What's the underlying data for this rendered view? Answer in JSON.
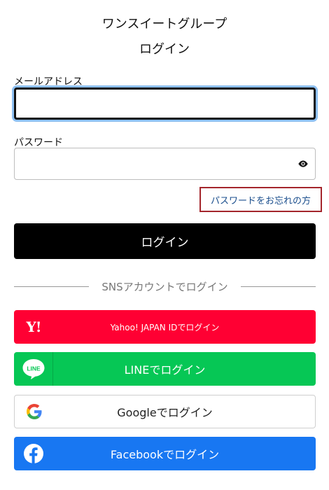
{
  "header": {
    "brand": "ワンスイートグループ",
    "page_title": "ログイン"
  },
  "form": {
    "email_label": "メールアドレス",
    "email_value": "",
    "password_label": "パスワード",
    "password_value": "",
    "forgot_link": "パスワードをお忘れの方",
    "login_button": "ログイン"
  },
  "divider": {
    "text": "SNSアカウントでログイン"
  },
  "sns": {
    "yahoo_label": "Yahoo! JAPAN IDでログイン",
    "yahoo_logo": "Y!",
    "line_label": "LINEでログイン",
    "line_logo": "LINE",
    "google_label": "Googleでログイン",
    "facebook_label": "Facebookでログイン"
  },
  "colors": {
    "login_button": "#000000",
    "yahoo": "#ff0033",
    "line": "#06c755",
    "facebook": "#1877f2",
    "forgot_border": "#a4262c",
    "focus_ring": "#8ec0f2"
  },
  "icons": {
    "password_toggle": "eye-icon",
    "yahoo": "yahoo-logo-icon",
    "line": "line-logo-icon",
    "google": "google-logo-icon",
    "facebook": "facebook-logo-icon"
  }
}
